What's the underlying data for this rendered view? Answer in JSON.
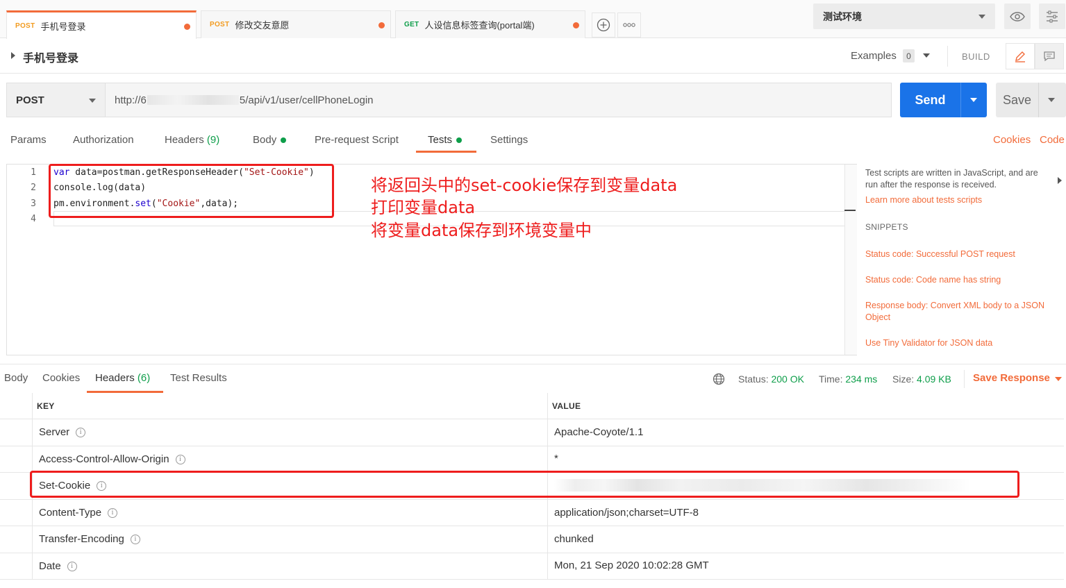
{
  "tabs": [
    {
      "method": "POST",
      "title": "手机号登录",
      "active": true
    },
    {
      "method": "POST",
      "title": "修改交友意愿",
      "active": false
    },
    {
      "method": "GET",
      "title": "人设信息标签查询(portal端)",
      "active": false
    }
  ],
  "tab_actions": {
    "new_tab_icon": "plus-circle-icon",
    "more_icon": "more-icon"
  },
  "environment": {
    "selected": "测试环境"
  },
  "request": {
    "name": "手机号登录",
    "examples_label": "Examples",
    "examples_count": "0",
    "build_label": "BUILD",
    "method": "POST",
    "url_prefix": "http://6",
    "url_suffix": "5/api/v1/user/cellPhoneLogin",
    "send_label": "Send",
    "save_label": "Save"
  },
  "request_tabs": {
    "params": "Params",
    "authorization": "Authorization",
    "headers": "Headers",
    "headers_count": "(9)",
    "body": "Body",
    "prerequest": "Pre-request Script",
    "tests": "Tests",
    "settings": "Settings",
    "cookies_link": "Cookies",
    "code_link": "Code"
  },
  "editor": {
    "line_numbers": [
      "1",
      "2",
      "3",
      "4"
    ],
    "lines": [
      {
        "kw": "var",
        "rest": " data=postman.getResponseHeader(",
        "str": "\"Set-Cookie\"",
        "end": ")"
      },
      {
        "plain": "console.log(data)"
      },
      {
        "pre": "pm.environment.",
        "fn": "set",
        "open": "(",
        "str": "\"Cookie\"",
        "end": ",data);"
      },
      {
        "plain": ""
      }
    ]
  },
  "annotations": [
    "将返回头中的set-cookie保存到变量data",
    "打印变量data",
    "将变量data保存到环境变量中"
  ],
  "side_panel": {
    "intro": "Test scripts are written in JavaScript, and are run after the response is received.",
    "learn_more": "Learn more about tests scripts",
    "snippets_heading": "SNIPPETS",
    "snippets": [
      "Status code: Successful POST request",
      "Status code: Code name has string",
      "Response body: Convert XML body to a JSON Object",
      "Use Tiny Validator for JSON data"
    ]
  },
  "response": {
    "tabs": {
      "body": "Body",
      "cookies": "Cookies",
      "headers": "Headers",
      "headers_count": "(6)",
      "test_results": "Test Results"
    },
    "status_label": "Status:",
    "status_value": "200 OK",
    "time_label": "Time:",
    "time_value": "234 ms",
    "size_label": "Size:",
    "size_value": "4.09 KB",
    "save_response": "Save Response",
    "columns": {
      "key": "KEY",
      "value": "VALUE"
    },
    "headers": [
      {
        "key": "Server",
        "value": "Apache-Coyote/1.1"
      },
      {
        "key": "Access-Control-Allow-Origin",
        "value": "*"
      },
      {
        "key": "Set-Cookie",
        "value": ""
      },
      {
        "key": "Content-Type",
        "value": "application/json;charset=UTF-8"
      },
      {
        "key": "Transfer-Encoding",
        "value": "chunked"
      },
      {
        "key": "Date",
        "value": "Mon, 21 Sep 2020 10:02:28 GMT"
      }
    ]
  },
  "colors": {
    "accent": "#f26b3a",
    "send": "#1a73e8",
    "success": "#0e9e4a",
    "annotation": "#ee1d1d"
  }
}
